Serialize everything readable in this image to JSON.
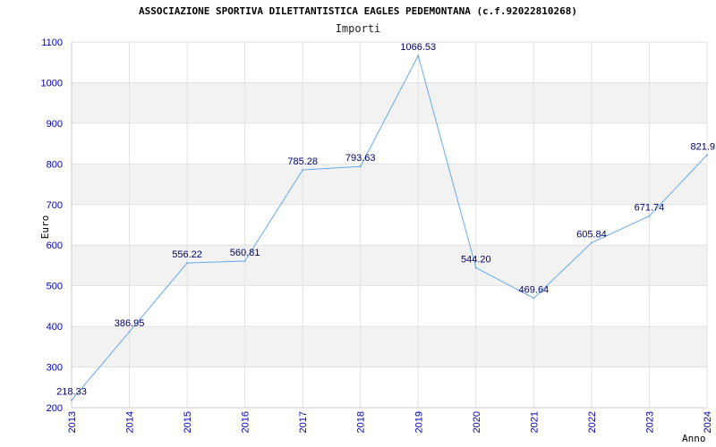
{
  "chart_data": {
    "type": "line",
    "title": "ASSOCIAZIONE SPORTIVA DILETTANTISTICA EAGLES PEDEMONTANA (c.f.92022810268)",
    "subtitle": "Importi",
    "xlabel": "Anno",
    "ylabel": "Euro",
    "x": [
      "2013",
      "2014",
      "2015",
      "2016",
      "2017",
      "2018",
      "2019",
      "2020",
      "2021",
      "2022",
      "2023",
      "2024"
    ],
    "series": [
      {
        "values": [
          218.33,
          386.95,
          556.22,
          560.81,
          785.28,
          793.63,
          1066.53,
          544.2,
          469.64,
          605.84,
          671.74,
          821.9
        ],
        "labels": [
          "218.33",
          "386.95",
          "556.22",
          "560.81",
          "785.28",
          "793.63",
          "1066.53",
          "544.20",
          "469.64",
          "605.84",
          "671.74",
          "821.9"
        ]
      }
    ],
    "ylim": [
      200,
      1100
    ],
    "yticks": [
      "200",
      "300",
      "400",
      "500",
      "600",
      "700",
      "800",
      "900",
      "1000",
      "1100"
    ],
    "grid": true,
    "colors": {
      "line": "#66aaee",
      "band": "#f2f2f2",
      "tick": "#0000aa"
    }
  }
}
